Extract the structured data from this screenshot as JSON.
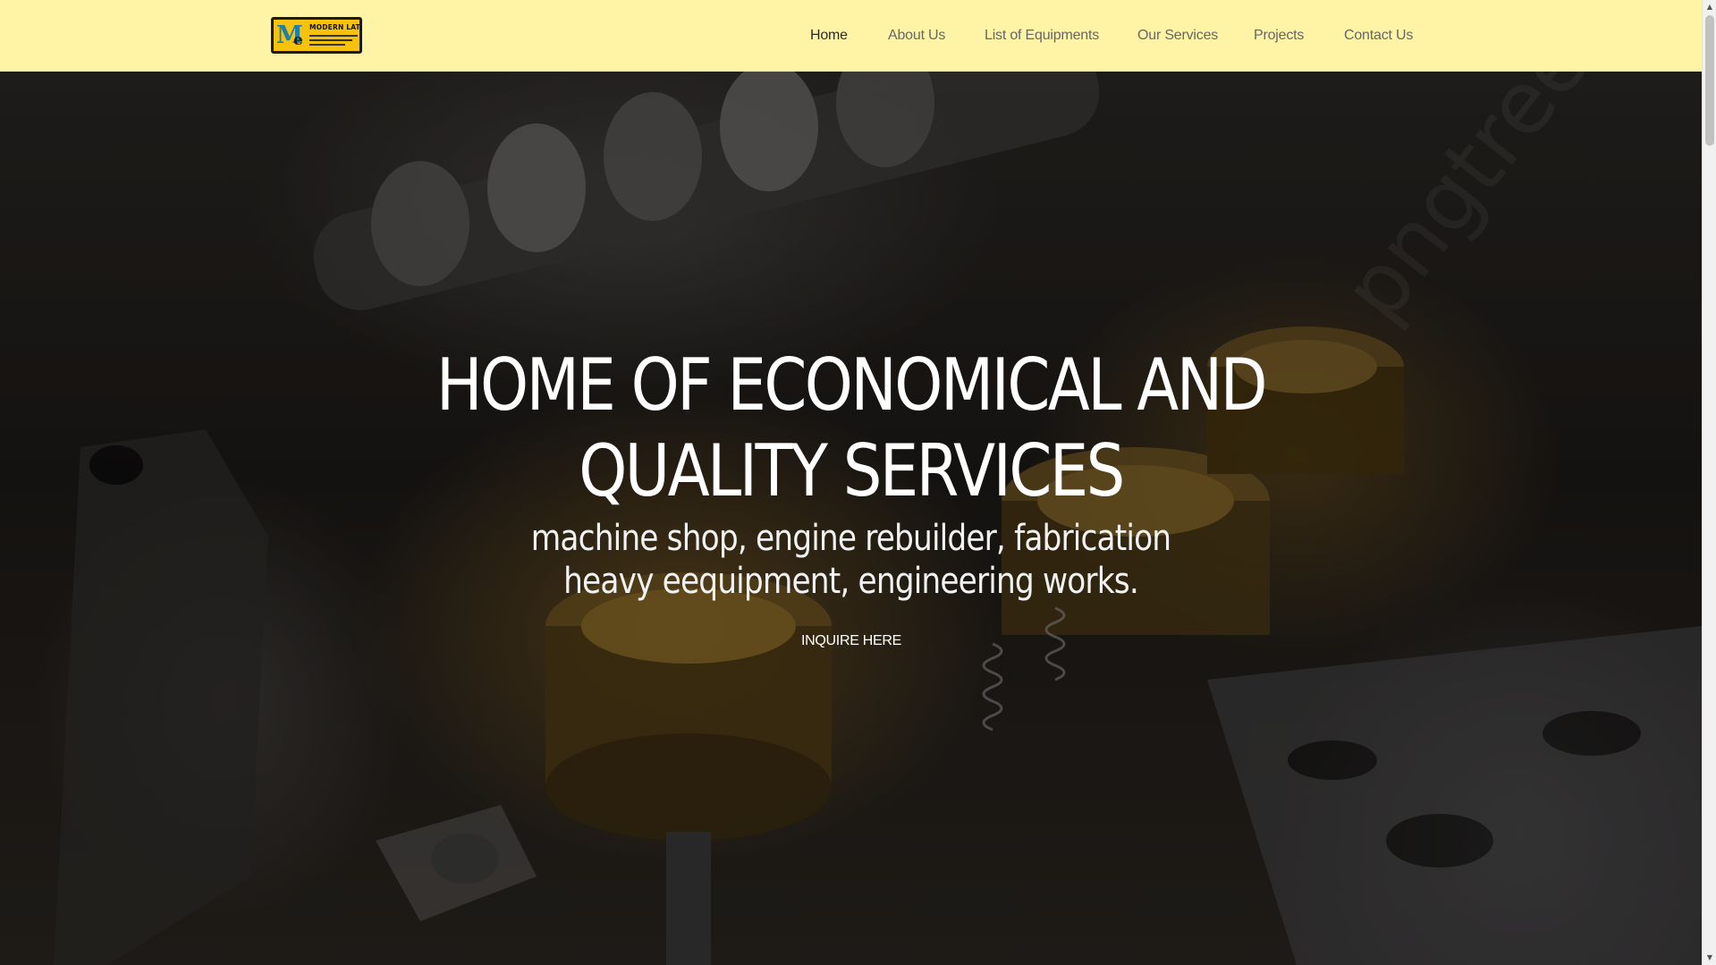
{
  "header": {
    "logo": {
      "text": "MODERN LATHE",
      "monogram_m": "M",
      "monogram_e": "e",
      "colors": {
        "background": "#f6c20c",
        "border": "#1b1b1b",
        "monogram": "#1f7fa4"
      }
    },
    "background_color": "#fff4a6",
    "nav": [
      {
        "label": "Home",
        "active": true
      },
      {
        "label": "About Us",
        "active": false
      },
      {
        "label": "List of Equipments",
        "active": false
      },
      {
        "label": "Our Services",
        "active": false
      },
      {
        "label": "Projects",
        "active": false
      },
      {
        "label": "Contact Us",
        "active": false
      }
    ]
  },
  "hero": {
    "title_lines": [
      "HOME OF ECONOMICAL AND",
      "QUALITY SERVICES"
    ],
    "subtitle_lines": [
      "machine shop, engine rebuilder, fabrication",
      "heavy eequipment, engineering works."
    ],
    "cta_label": "INQUIRE HERE",
    "background_description_icon": "engine-camshaft-pistons-photo",
    "watermark": "pngtree"
  },
  "scrollbar": {
    "up_icon": "chevron-up-icon",
    "down_icon": "chevron-down-icon"
  }
}
